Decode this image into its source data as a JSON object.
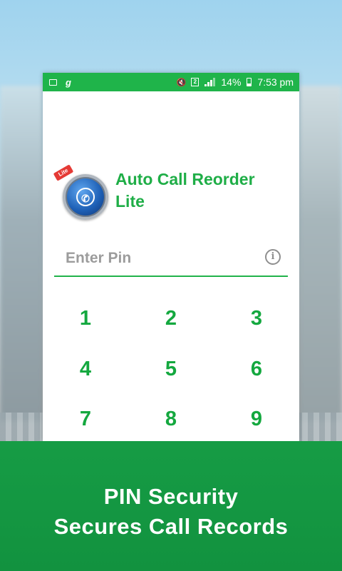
{
  "status_bar": {
    "left_icons": [
      "image-icon",
      "g-icon"
    ],
    "g_glyph": "g",
    "sim_glyph": "2",
    "battery_percent": "14%",
    "time": "7:53 pm",
    "right_icons": [
      "vibrate-icon",
      "sim-icon",
      "signal-icon",
      "battery-icon"
    ]
  },
  "app": {
    "name": "Auto Call Reorder Lite",
    "badge": "Lite",
    "accent_color": "#1fb44a"
  },
  "pin": {
    "placeholder": "Enter Pin",
    "info_glyph": "i"
  },
  "keypad": {
    "keys": [
      "1",
      "2",
      "3",
      "4",
      "5",
      "6",
      "7",
      "8",
      "9"
    ]
  },
  "banner": {
    "line1": "PIN Security",
    "line2": "Secures Call Records",
    "background": "#169c45"
  }
}
